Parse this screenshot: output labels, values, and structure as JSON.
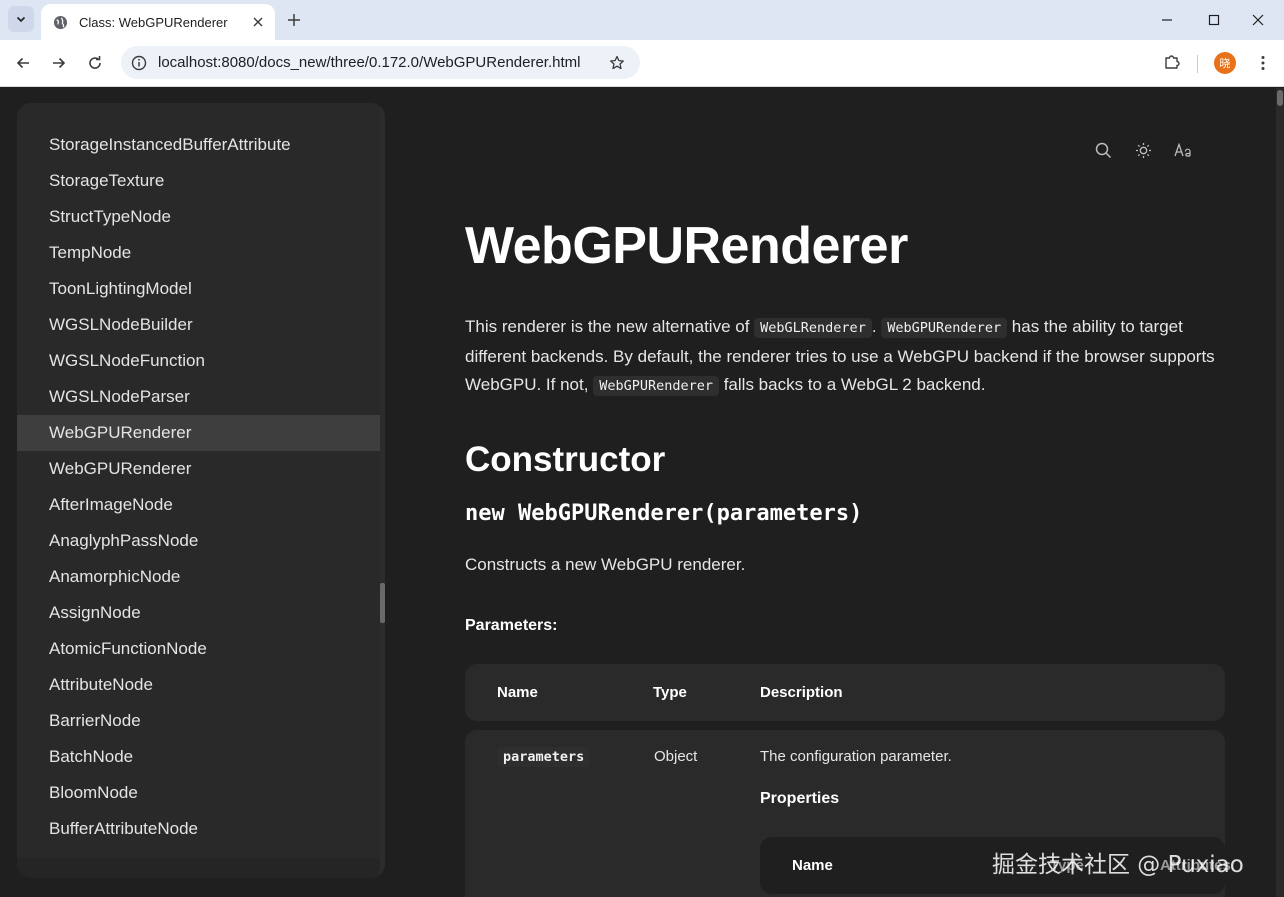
{
  "browser": {
    "tab_title": "Class: WebGPURenderer",
    "url": "localhost:8080/docs_new/three/0.172.0/WebGPURenderer.html",
    "profile_initial": "晓"
  },
  "sidebar": {
    "items": [
      {
        "label": "StorageInstancedBufferAttribute"
      },
      {
        "label": "StorageTexture"
      },
      {
        "label": "StructTypeNode"
      },
      {
        "label": "TempNode"
      },
      {
        "label": "ToonLightingModel"
      },
      {
        "label": "WGSLNodeBuilder"
      },
      {
        "label": "WGSLNodeFunction"
      },
      {
        "label": "WGSLNodeParser"
      },
      {
        "label": "WebGPURenderer",
        "active": true
      },
      {
        "label": "WebGPURenderer"
      },
      {
        "label": "AfterImageNode"
      },
      {
        "label": "AnaglyphPassNode"
      },
      {
        "label": "AnamorphicNode"
      },
      {
        "label": "AssignNode"
      },
      {
        "label": "AtomicFunctionNode"
      },
      {
        "label": "AttributeNode"
      },
      {
        "label": "BarrierNode"
      },
      {
        "label": "BatchNode"
      },
      {
        "label": "BloomNode"
      },
      {
        "label": "BufferAttributeNode"
      }
    ]
  },
  "main": {
    "title": "WebGPURenderer",
    "intro": {
      "p1": "This renderer is the new alternative of ",
      "code1": "WebGLRenderer",
      "p2": ". ",
      "code2": "WebGPURenderer",
      "p3": " has the ability to target different backends. By default, the renderer tries to use a WebGPU backend if the browser supports WebGPU. If not, ",
      "code3": "WebGPURenderer",
      "p4": " falls backs to a WebGL 2 backend."
    },
    "constructor_heading": "Constructor",
    "signature": "new WebGPURenderer(parameters)",
    "constructor_desc": "Constructs a new WebGPU renderer.",
    "parameters_label": "Parameters:",
    "table": {
      "headers": [
        "Name",
        "Type",
        "Description"
      ],
      "rows": [
        {
          "name": "parameters",
          "type": "Object",
          "description": "The configuration parameter.",
          "properties_label": "Properties"
        }
      ],
      "sub_headers": [
        "Name",
        "Type",
        "Attributes"
      ]
    }
  },
  "watermark": "掘金技术社区 @ Puxiao"
}
